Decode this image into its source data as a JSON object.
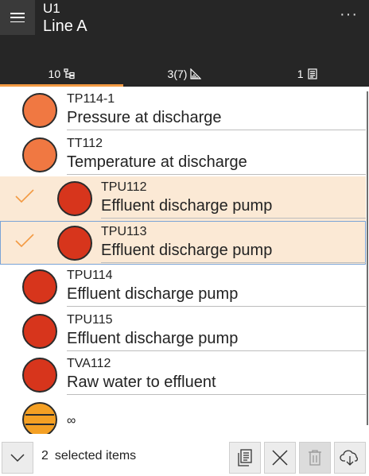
{
  "header": {
    "menu_icon": "hamburger-icon",
    "title_small": "U1",
    "title_large": "Line A",
    "more_icon": "more-horizontal-icon",
    "more_glyph": "···"
  },
  "tabs": [
    {
      "label": "10",
      "icon": "hierarchy-icon",
      "active": true
    },
    {
      "label": "3(7)",
      "icon": "diagram-icon",
      "active": false
    },
    {
      "label": "1",
      "icon": "document-icon",
      "active": false
    }
  ],
  "list": {
    "items": [
      {
        "code": "TP114-1",
        "desc": "Pressure at discharge",
        "status": "orange",
        "selected": false
      },
      {
        "code": "TT112",
        "desc": "Temperature at discharge",
        "status": "orange",
        "selected": false
      },
      {
        "code": "TPU112",
        "desc": "Effluent discharge pump",
        "status": "red",
        "selected": true
      },
      {
        "code": "TPU113",
        "desc": "Effluent discharge pump",
        "status": "red",
        "selected": true
      },
      {
        "code": "TPU114",
        "desc": "Effluent discharge pump",
        "status": "red",
        "selected": false
      },
      {
        "code": "TPU115",
        "desc": "Effluent discharge pump",
        "status": "red",
        "selected": false
      },
      {
        "code": "TVA112",
        "desc": "Raw water to effluent",
        "status": "red",
        "selected": false
      },
      {
        "code": "∞",
        "desc": "",
        "status": "ring",
        "selected": false
      }
    ]
  },
  "colors": {
    "header_bg": "#262626",
    "accent": "#f39a43",
    "selected_bg": "#fbe9d5",
    "status_orange": "#f07842",
    "status_red": "#d7351c",
    "status_amber": "#f4a024"
  },
  "bottom_bar": {
    "expand_icon": "chevron-down-icon",
    "selected_count": "2",
    "selected_label": "selected items",
    "actions": [
      {
        "icon": "copy-document-icon",
        "enabled": true
      },
      {
        "icon": "close-icon",
        "enabled": true
      },
      {
        "icon": "trash-icon",
        "enabled": false
      },
      {
        "icon": "cloud-download-icon",
        "enabled": true
      }
    ]
  }
}
